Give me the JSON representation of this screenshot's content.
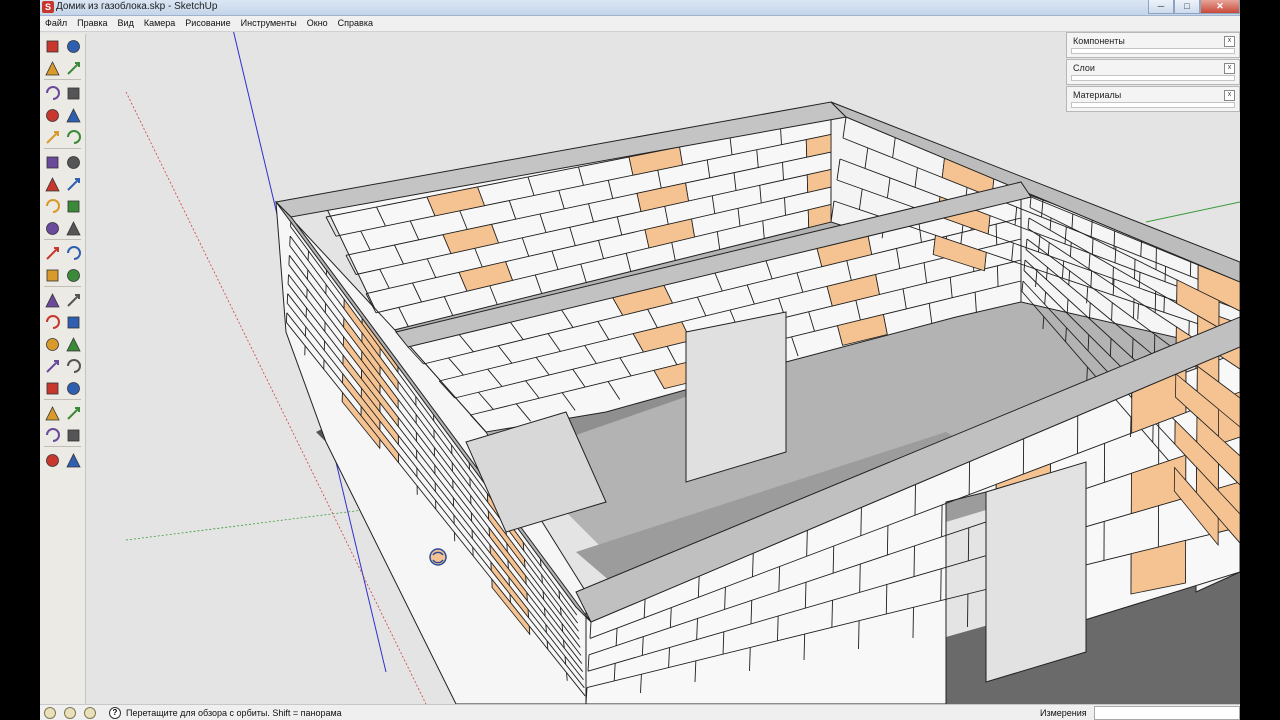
{
  "window": {
    "title": "Домик из газоблока.skp - SketchUp",
    "app_icon": "sketchup-icon",
    "controls": [
      "─",
      "□",
      "✕"
    ]
  },
  "menu": [
    "Файл",
    "Правка",
    "Вид",
    "Камера",
    "Рисование",
    "Инструменты",
    "Окно",
    "Справка"
  ],
  "tools": [
    "select-tool",
    "component-tool",
    "paint-bucket-tool",
    "eraser-tool",
    "rectangle-tool",
    "line-tool",
    "circle-tool",
    "arc-tool",
    "polygon-tool",
    "freehand-tool",
    "move-tool",
    "push-pull-tool",
    "rotate-tool",
    "follow-me-tool",
    "scale-tool",
    "offset-tool",
    "tape-measure-tool",
    "dimension-tool",
    "protractor-tool",
    "text-tool",
    "axes-tool",
    "3d-text-tool",
    "orbit-tool",
    "pan-tool",
    "zoom-tool",
    "zoom-window-tool",
    "zoom-extents-tool",
    "previous-view-tool",
    "position-camera-tool",
    "look-around-tool",
    "walk-tool",
    "section-plane-tool",
    "warehouse-tool",
    "share-model-tool",
    "get-models-tool",
    "upload-component-tool",
    "extension-tool",
    "layer-tool"
  ],
  "trays": [
    {
      "title": "Компоненты",
      "close": "x"
    },
    {
      "title": "Слои",
      "close": "x"
    },
    {
      "title": "Материалы",
      "close": "x"
    }
  ],
  "statusbar": {
    "icons": [
      "geo-location-icon",
      "credits-icon",
      "user-icon"
    ],
    "help_icon": "?",
    "hint": "Перетащите для обзора с орбиты.  Shift = панорама",
    "measure_label": "Измерения",
    "measure_value": ""
  },
  "colors": {
    "block_white": "#f7f7f7",
    "block_orange": "#f5c392",
    "beam_gray": "#bdbdbd",
    "foundation": "#6a6a6a",
    "floor": "#b5b5b5",
    "axis_red": "#d04040",
    "axis_green": "#3a9a3a",
    "axis_blue": "#3030d0"
  }
}
